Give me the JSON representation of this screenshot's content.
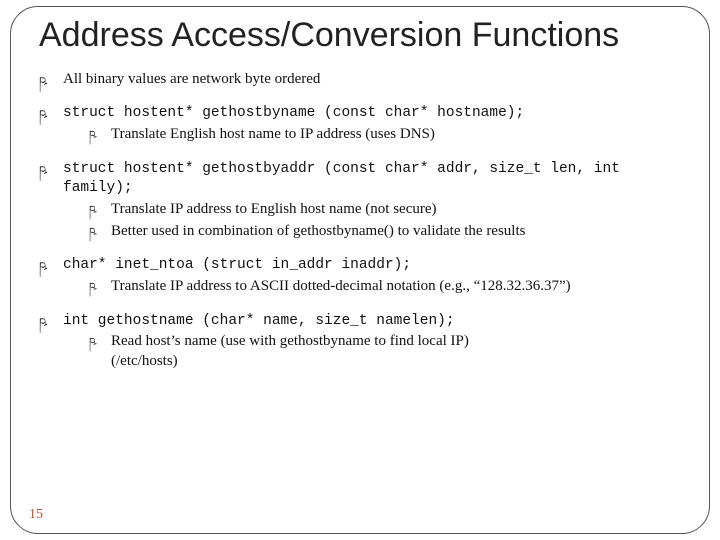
{
  "title": "Address Access/Conversion Functions",
  "items": [
    {
      "text": "All binary values are network byte ordered",
      "code": false,
      "subs": []
    },
    {
      "text": "struct hostent* gethostbyname (const char* hostname);",
      "code": true,
      "subs": [
        {
          "text": "Translate English host name to IP address (uses DNS)"
        }
      ]
    },
    {
      "text": "struct hostent* gethostbyaddr (const char* addr, size_t len, int family);",
      "code": true,
      "subs": [
        {
          "text": "Translate IP address to English host name (not secure)"
        },
        {
          "text": "Better used in combination of gethostbyname() to validate the results"
        }
      ]
    },
    {
      "text": "char* inet_ntoa (struct in_addr inaddr);",
      "code": true,
      "subs": [
        {
          "text": "Translate IP address to ASCII dotted-decimal notation (e.g., “128.32.36.37”)"
        }
      ]
    },
    {
      "text": "int gethostname (char* name, size_t namelen);",
      "code": true,
      "subs": [
        {
          "text": "Read host’s name (use with gethostbyname to find local IP)"
        }
      ],
      "trailing": "(/etc/hosts)"
    }
  ],
  "bullet_glyph": "ཥ",
  "page_number": "15"
}
